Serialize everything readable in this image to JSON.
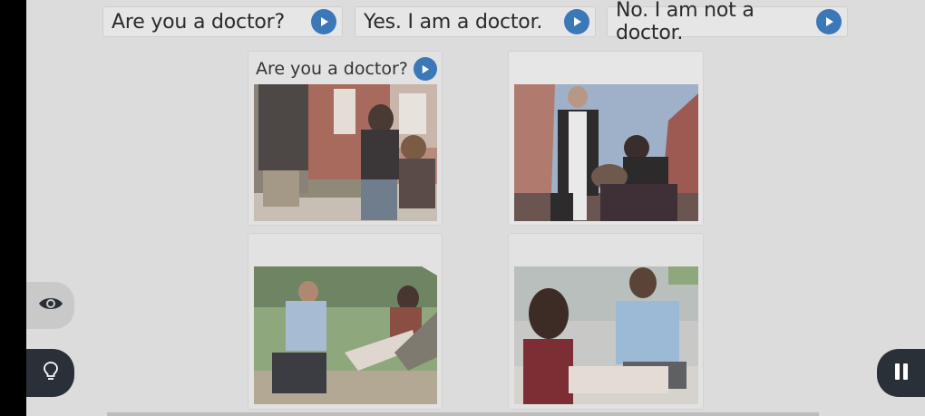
{
  "phrases": [
    {
      "text": "Are you a doctor?"
    },
    {
      "text": "Yes. I am a doctor."
    },
    {
      "text": "No. I am not a doctor."
    }
  ],
  "cards": [
    {
      "caption": "Are you a doctor?"
    }
  ],
  "controls": {
    "eye_icon": "eye-icon",
    "hint_icon": "lightbulb-icon",
    "pause_icon": "pause-icon"
  },
  "colors": {
    "play_button": "#3a78b8",
    "background": "#dcdcdc",
    "dark_button": "#2a3038"
  }
}
